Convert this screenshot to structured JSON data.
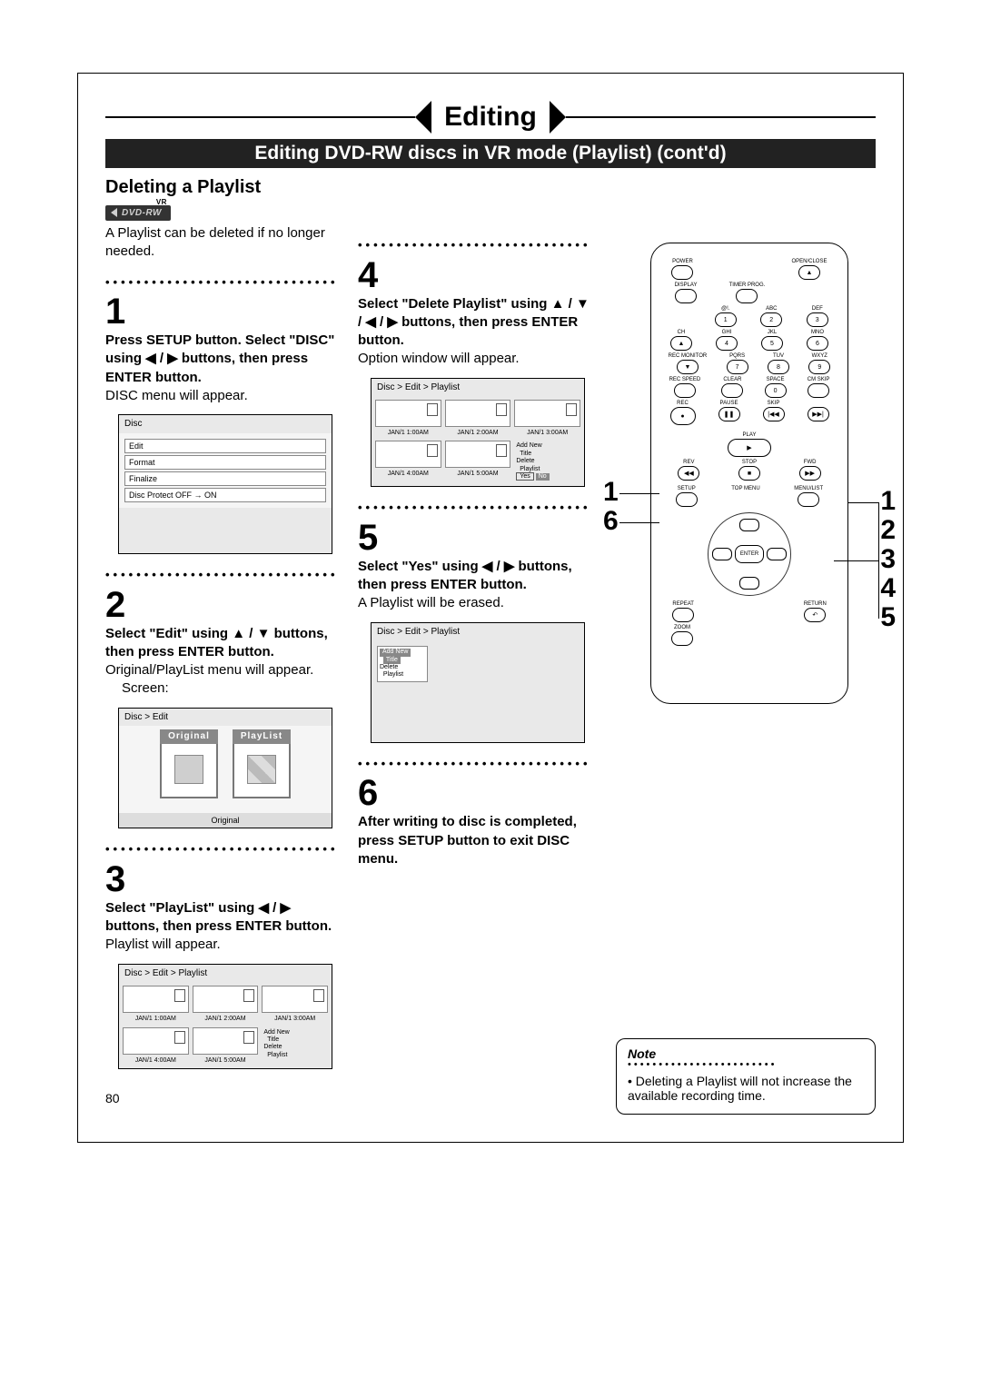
{
  "chapter_title": "Editing",
  "subtitle": "Editing DVD-RW discs in VR mode (Playlist) (cont'd)",
  "section_title": "Deleting a Playlist",
  "badge_text": "DVD-RW",
  "badge_vr": "VR",
  "intro": "A Playlist can be deleted if no longer needed.",
  "page_number": "80",
  "steps": {
    "s1": {
      "num": "1",
      "bold": "Press SETUP button. Select \"DISC\" using ◀ / ▶ buttons, then press ENTER button.",
      "body": "DISC menu will appear."
    },
    "s2": {
      "num": "2",
      "bold": "Select \"Edit\" using ▲ / ▼ buttons, then press ENTER button.",
      "body": "Original/PlayList menu will appear.",
      "body2": "Screen:"
    },
    "s3": {
      "num": "3",
      "bold": "Select \"PlayList\" using ◀ / ▶ buttons, then press ENTER button.",
      "body": "Playlist will appear."
    },
    "s4": {
      "num": "4",
      "bold": "Select \"Delete Playlist\" using ▲ / ▼ / ◀ / ▶ buttons, then press ENTER button.",
      "body": "Option window will appear."
    },
    "s5": {
      "num": "5",
      "bold": "Select \"Yes\" using ◀ / ▶ buttons, then press ENTER button.",
      "body": "A Playlist will be erased."
    },
    "s6": {
      "num": "6",
      "bold": "After writing to disc is completed, press SETUP button to exit DISC menu."
    }
  },
  "osd": {
    "disc": {
      "title": "Disc",
      "items": [
        "Edit",
        "Format",
        "Finalize",
        "Disc Protect OFF → ON"
      ]
    },
    "edit": {
      "crumb": "Disc > Edit",
      "original": "Original",
      "playlist": "PlayList",
      "footer": "Original"
    },
    "playlist": {
      "crumb": "Disc > Edit > Playlist",
      "caps": [
        "JAN/1 1:00AM",
        "JAN/1 2:00AM",
        "JAN/1 3:00AM",
        "JAN/1 4:00AM",
        "JAN/1 5:00AM"
      ],
      "menu": {
        "add": "Add New",
        "title": "Title",
        "delete": "Delete",
        "playlist": "Playlist"
      }
    },
    "confirm": {
      "crumb": "Disc > Edit > Playlist",
      "yes": "Yes",
      "no": "No"
    },
    "after": {
      "crumb": "Disc > Edit > Playlist",
      "menu": {
        "add": "Add New",
        "title": "Title",
        "delete": "Delete",
        "playlist": "Playlist"
      }
    }
  },
  "remote": {
    "power": "POWER",
    "openclose": "OPEN/CLOSE",
    "display": "DISPLAY",
    "timer": "TIMER PROG.",
    "at": "@!.",
    "abc": "ABC",
    "def": "DEF",
    "n1": "1",
    "n2": "2",
    "n3": "3",
    "ch": "CH",
    "ghi": "GHI",
    "jkl": "JKL",
    "mno": "MNO",
    "n4": "4",
    "n5": "5",
    "n6": "6",
    "pqrs": "PQRS",
    "tuv": "TUV",
    "wxyz": "WXYZ",
    "n7": "7",
    "n8": "8",
    "n9": "9",
    "recspeed": "REC SPEED",
    "recmon": "REC MONITOR",
    "clear": "CLEAR",
    "space": "SPACE",
    "cmskip": "CM SKIP",
    "n0": "0",
    "rec": "REC",
    "pause": "PAUSE",
    "skip": "SKIP",
    "play": "PLAY",
    "rev": "REV",
    "fwd": "FWD",
    "stop": "STOP",
    "setup": "SETUP",
    "topmenu": "TOP MENU",
    "menulist": "MENU/LIST",
    "repeat": "REPEAT",
    "enter": "ENTER",
    "zoom": "ZOOM",
    "return": "RETURN"
  },
  "callouts_left": [
    "1",
    "6"
  ],
  "callouts_right": [
    "1",
    "2",
    "3",
    "4",
    "5"
  ],
  "note": {
    "title": "Note",
    "body": "• Deleting a Playlist will not increase the available recording time."
  }
}
